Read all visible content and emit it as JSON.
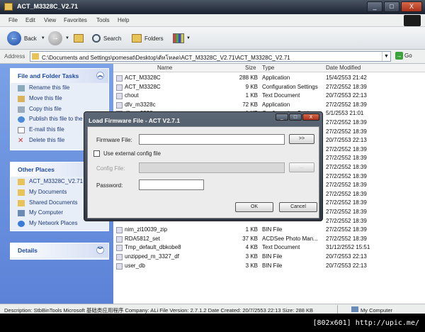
{
  "window": {
    "title": "ACT_M3328C_V2.71",
    "caption_buttons": [
      "_",
      "□",
      "X"
    ]
  },
  "menu": [
    "File",
    "Edit",
    "View",
    "Favorites",
    "Tools",
    "Help"
  ],
  "toolbar": {
    "back": "Back",
    "search": "Search",
    "folders": "Folders",
    "views_label": ""
  },
  "address": {
    "label": "Address",
    "value": "C:\\Documents and Settings\\pomesat\\Desktop\\ดัทโหลด\\ACT_M3328C_V2.71\\ACT_M3328C_V2.71",
    "go": "Go"
  },
  "tasks": {
    "title": "File and Folder Tasks",
    "items": [
      "Rename this file",
      "Move this file",
      "Copy this file",
      "Publish this file to the Web",
      "E-mail this file",
      "Delete this file"
    ]
  },
  "other_places": {
    "title": "Other Places",
    "items": [
      "ACT_M3328C_V2.71",
      "My Documents",
      "Shared Documents",
      "My Computer",
      "My Network Places"
    ]
  },
  "details": {
    "title": "Details"
  },
  "columns": {
    "name": "Name",
    "size": "Size",
    "type": "Type",
    "date": "Date Modified"
  },
  "files": [
    {
      "name": "ACT_M3328C",
      "size": "288 KB",
      "type": "Application",
      "date": "15/4/2553 21:42"
    },
    {
      "name": "ACT_M3328C",
      "size": "9 KB",
      "type": "Configuration Settings",
      "date": "27/2/2552 18:39"
    },
    {
      "name": "chout",
      "size": "1 KB",
      "type": "Text Document",
      "date": "20/7/2553 22:13"
    },
    {
      "name": "dfv_m3328c",
      "size": "72 KB",
      "type": "Application",
      "date": "27/2/2552 18:39"
    },
    {
      "name": "dfv_m3328c",
      "size": "1 KB",
      "type": "Configuration Settings",
      "date": "5/1/2553 21:01"
    },
    {
      "name": "",
      "size": "",
      "type": "",
      "date": "27/2/2552 18:39"
    },
    {
      "name": "",
      "size": "",
      "type": "",
      "date": "27/2/2552 18:39"
    },
    {
      "name": "",
      "size": "",
      "type": "",
      "date": "20/7/2553 22:13"
    },
    {
      "name": "",
      "size": "",
      "type": "",
      "date": "27/2/2552 18:39"
    },
    {
      "name": "",
      "size": "",
      "type": "",
      "date": "27/2/2552 18:39"
    },
    {
      "name": "",
      "size": "",
      "type": "",
      "date": "27/2/2552 18:39"
    },
    {
      "name": "",
      "size": "",
      "type": "",
      "date": "27/2/2552 18:39"
    },
    {
      "name": "",
      "size": "",
      "type": "",
      "date": "27/2/2552 18:39"
    },
    {
      "name": "",
      "size": "",
      "type": "",
      "date": "27/2/2552 18:39"
    },
    {
      "name": "",
      "size": "",
      "type": "",
      "date": "27/2/2552 18:39"
    },
    {
      "name": "",
      "size": "",
      "type": "",
      "date": "27/2/2552 18:39"
    },
    {
      "name": "",
      "size": "",
      "type": "",
      "date": "27/2/2552 18:39"
    },
    {
      "name": "nim_zl10039_zip",
      "size": "1 KB",
      "type": "BIN File",
      "date": "27/2/2552 18:39"
    },
    {
      "name": "RDA5812_set",
      "size": "37 KB",
      "type": "ACDSee Photo Man...",
      "date": "27/2/2552 18:39"
    },
    {
      "name": "Tmp_default_dbkobe8",
      "size": "4 KB",
      "type": "Text Document",
      "date": "31/12/2552 15:51"
    },
    {
      "name": "unzipped_m_3327_df",
      "size": "3 KB",
      "type": "BIN File",
      "date": "20/7/2553 22:13"
    },
    {
      "name": "user_db",
      "size": "3 KB",
      "type": "BIN File",
      "date": "20/7/2553 22:13"
    }
  ],
  "status": {
    "description": "Description: StbBinTools Microsoft 基础类应用程序 Company: ALi File Version: 2.7.1.2 Date Created: 20/7/2553 22:13 Size: 288 KB",
    "location": "My Computer"
  },
  "footer": "[802x601] http://upic.me/",
  "dialog": {
    "title": "Load Firmware File - ACT V2.7.1",
    "firmware_label": "Firmware File:",
    "firmware_value": "",
    "browse": ">>",
    "use_external": "Use external config file",
    "config_label": "Config File:",
    "config_browse": "...",
    "password_label": "Password:",
    "ok": "OK",
    "cancel": "Cancel"
  }
}
